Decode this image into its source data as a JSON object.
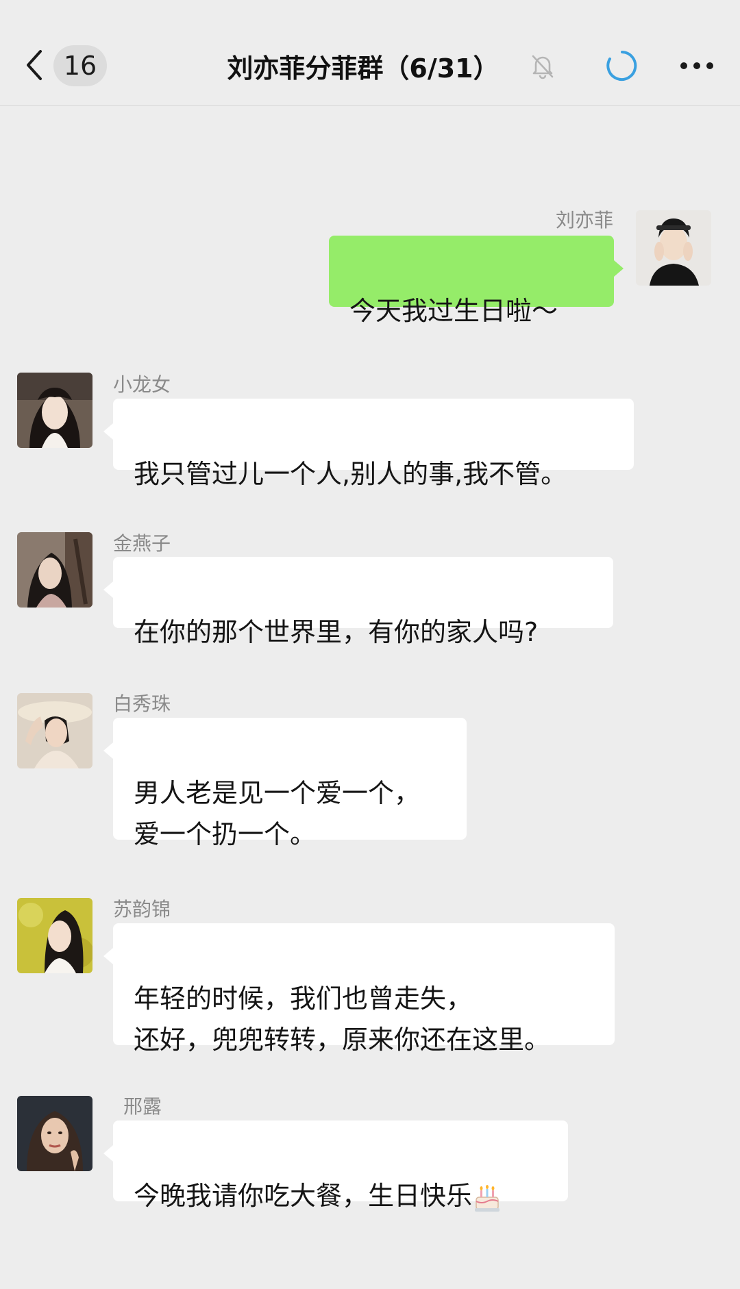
{
  "header": {
    "unread_count": "16",
    "title": "刘亦菲分菲群（6/31）",
    "icons": {
      "back": "chevron-left-icon",
      "mute": "bell-off-icon",
      "loading": "loading-ring-icon",
      "more": "ellipsis-icon"
    },
    "loading_color": "#3aa0e0"
  },
  "messages": [
    {
      "sender": "刘亦菲",
      "text": "今天我过生日啦～",
      "self": true
    },
    {
      "sender": "小龙女",
      "text": "我只管过儿一个人,别人的事,我不管。",
      "self": false
    },
    {
      "sender": "金燕子",
      "text": "在你的那个世界里，有你的家人吗?",
      "self": false
    },
    {
      "sender": "白秀珠",
      "text": "男人老是见一个爱一个，\n爱一个扔一个。",
      "self": false
    },
    {
      "sender": "苏韵锦",
      "text": "年轻的时候，我们也曾走失，\n还好，兜兜转转，原来你还在这里。",
      "self": false
    },
    {
      "sender": "邢露",
      "text": "今晚我请你吃大餐，生日快乐",
      "emoji": "birthday-cake-icon",
      "self": false
    }
  ],
  "colors": {
    "background": "#ededed",
    "self_bubble": "#95ec69",
    "other_bubble": "#ffffff",
    "name_text": "#8a8a8a"
  }
}
